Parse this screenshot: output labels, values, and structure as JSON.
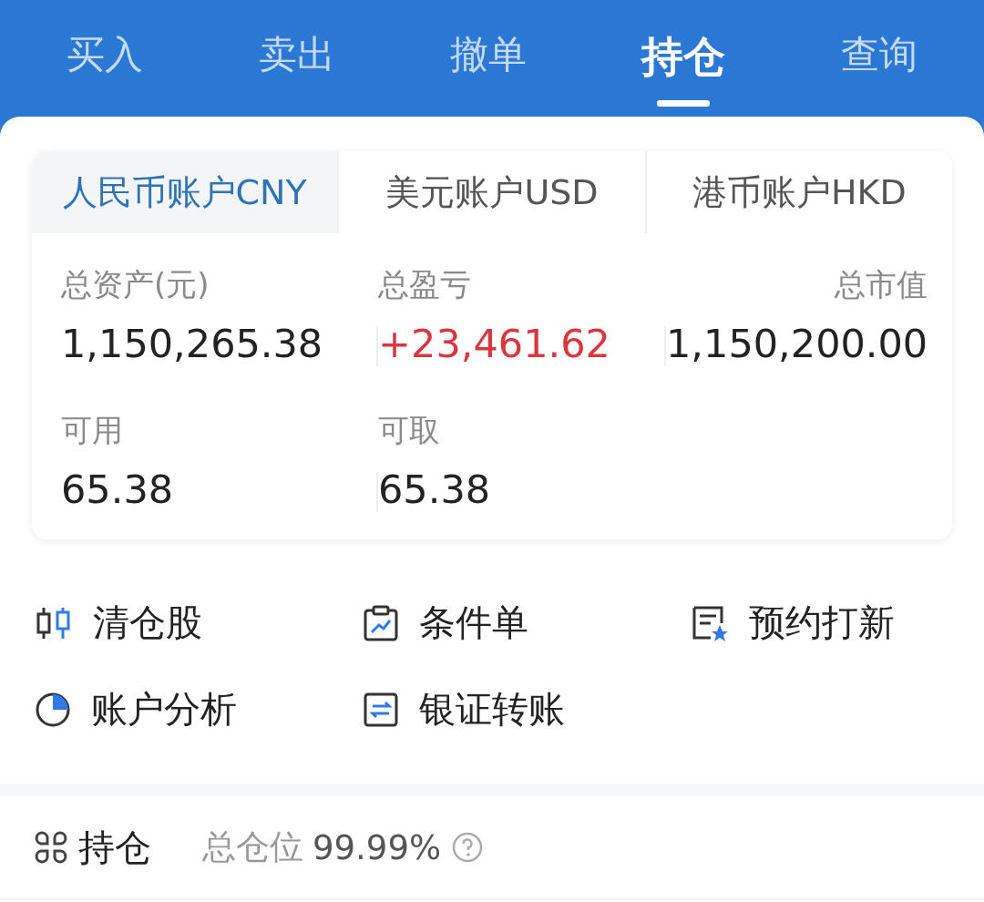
{
  "top_tabs": [
    {
      "label": "买入",
      "selected": false
    },
    {
      "label": "卖出",
      "selected": false
    },
    {
      "label": "撤单",
      "selected": false
    },
    {
      "label": "持仓",
      "selected": true
    },
    {
      "label": "查询",
      "selected": false
    }
  ],
  "account_tabs": [
    {
      "label": "人民币账户CNY",
      "selected": true
    },
    {
      "label": "美元账户USD",
      "selected": false
    },
    {
      "label": "港币账户HKD",
      "selected": false
    }
  ],
  "summary_rows": [
    [
      {
        "label": "总资产(元)",
        "value": "1,150,265.38",
        "kind": "plain"
      },
      {
        "label": "总盈亏",
        "value": "+23,461.62",
        "kind": "gain"
      },
      {
        "label": "总市值",
        "value": "1,150,200.00",
        "kind": "plain"
      }
    ],
    [
      {
        "label": "可用",
        "value": "65.38",
        "kind": "plain"
      },
      {
        "label": "可取",
        "value": "65.38",
        "kind": "plain"
      }
    ]
  ],
  "actions": [
    {
      "label": "清仓股",
      "kind": "candles"
    },
    {
      "label": "条件单",
      "kind": "clipboard"
    },
    {
      "label": "预约打新",
      "kind": "ticket"
    },
    {
      "label": "账户分析",
      "kind": "pie"
    },
    {
      "label": "银证转账",
      "kind": "transfer"
    }
  ],
  "holdings": {
    "title": "持仓",
    "position_label": "总仓位",
    "position_value": "99.99%"
  }
}
